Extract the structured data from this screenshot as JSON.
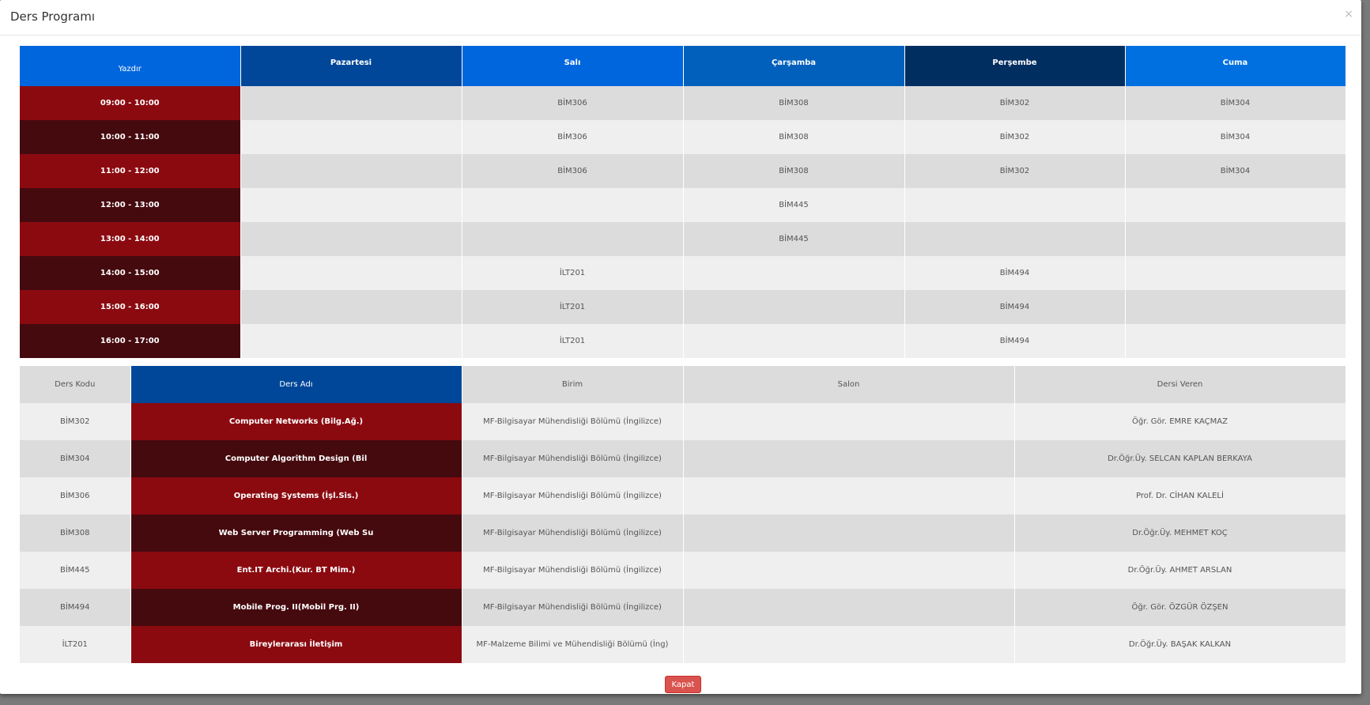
{
  "modal": {
    "title": "Ders Programı",
    "close_symbol": "×"
  },
  "schedule": {
    "print_label": "Yazdır",
    "days": [
      {
        "label": "Pazartesi",
        "color": "#004799"
      },
      {
        "label": "Salı",
        "color": "#0066dd"
      },
      {
        "label": "Çarşamba",
        "color": "#0060bb"
      },
      {
        "label": "Perşembe",
        "color": "#002e60"
      },
      {
        "label": "Cuma",
        "color": "#0070e0"
      }
    ],
    "print_color": "#0066dd",
    "rows": [
      {
        "time": "09:00 - 10:00",
        "cells": [
          "",
          "BİM306",
          "BİM308",
          "BİM302",
          "BİM304"
        ]
      },
      {
        "time": "10:00 - 11:00",
        "cells": [
          "",
          "BİM306",
          "BİM308",
          "BİM302",
          "BİM304"
        ]
      },
      {
        "time": "11:00 - 12:00",
        "cells": [
          "",
          "BİM306",
          "BİM308",
          "BİM302",
          "BİM304"
        ]
      },
      {
        "time": "12:00 - 13:00",
        "cells": [
          "",
          "",
          "BİM445",
          "",
          ""
        ]
      },
      {
        "time": "13:00 - 14:00",
        "cells": [
          "",
          "",
          "BİM445",
          "",
          ""
        ]
      },
      {
        "time": "14:00 - 15:00",
        "cells": [
          "",
          "İLT201",
          "",
          "BİM494",
          ""
        ]
      },
      {
        "time": "15:00 - 16:00",
        "cells": [
          "",
          "İLT201",
          "",
          "BİM494",
          ""
        ]
      },
      {
        "time": "16:00 - 17:00",
        "cells": [
          "",
          "İLT201",
          "",
          "BİM494",
          ""
        ]
      }
    ]
  },
  "courses": {
    "headers": {
      "code": "Ders Kodu",
      "name": "Ders Adı",
      "unit": "Birim",
      "room": "Salon",
      "instructor": "Dersi Veren"
    },
    "rows": [
      {
        "code": "BİM302",
        "name": "Computer Networks (Bilg.Ağ.)",
        "unit": "MF-Bilgisayar Mühendisliği Bölümü (İngilizce)",
        "room": "",
        "instructor": "Öğr. Gör. EMRE KAÇMAZ"
      },
      {
        "code": "BİM304",
        "name": "Computer Algorithm Design (Bil",
        "unit": "MF-Bilgisayar Mühendisliği Bölümü (İngilizce)",
        "room": "",
        "instructor": "Dr.Öğr.Üy. SELCAN KAPLAN BERKAYA"
      },
      {
        "code": "BİM306",
        "name": "Operating Systems (İşl.Sis.)",
        "unit": "MF-Bilgisayar Mühendisliği Bölümü (İngilizce)",
        "room": "",
        "instructor": "Prof. Dr. CİHAN KALELİ"
      },
      {
        "code": "BİM308",
        "name": "Web Server Programming (Web Su",
        "unit": "MF-Bilgisayar Mühendisliği Bölümü (İngilizce)",
        "room": "",
        "instructor": "Dr.Öğr.Üy. MEHMET KOÇ"
      },
      {
        "code": "BİM445",
        "name": "Ent.IT Archi.(Kur. BT Mim.)",
        "unit": "MF-Bilgisayar Mühendisliği Bölümü (İngilizce)",
        "room": "",
        "instructor": "Dr.Öğr.Üy. AHMET ARSLAN"
      },
      {
        "code": "BİM494",
        "name": "Mobile Prog. II(Mobil Prg. II)",
        "unit": "MF-Bilgisayar Mühendisliği Bölümü (İngilizce)",
        "room": "",
        "instructor": "Öğr. Gör. ÖZGÜR ÖZŞEN"
      },
      {
        "code": "İLT201",
        "name": "Bireylerarası İletişim",
        "unit": "MF-Malzeme Bilimi ve Mühendisliği Bölümü (İng)",
        "room": "",
        "instructor": "Dr.Öğr.Üy. BAŞAK KALKAN"
      }
    ]
  },
  "footer": {
    "close_label": "Kapat"
  }
}
